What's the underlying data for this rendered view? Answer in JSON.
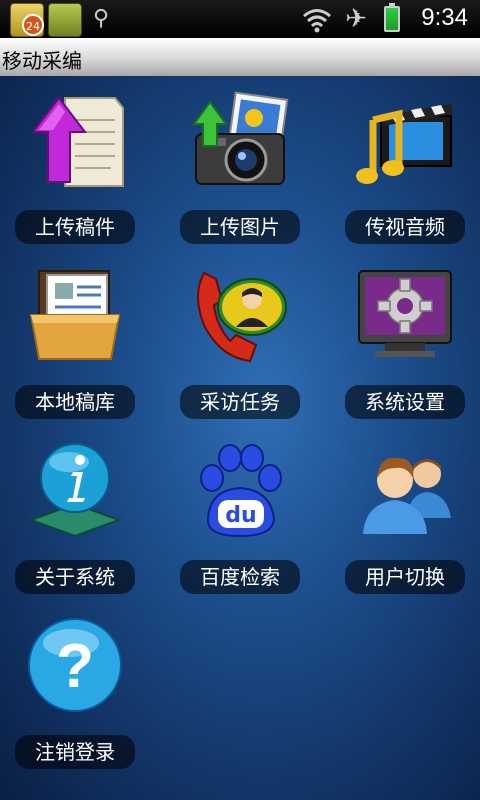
{
  "status_bar": {
    "notification_count": "24",
    "time": "9:34"
  },
  "title_bar": {
    "title": "移动采编"
  },
  "menu": {
    "items": [
      {
        "label": "上传稿件",
        "icon": "upload-document-icon"
      },
      {
        "label": "上传图片",
        "icon": "upload-picture-icon"
      },
      {
        "label": "传视音频",
        "icon": "media-music-video-icon"
      },
      {
        "label": "本地稿库",
        "icon": "local-archive-folder-icon"
      },
      {
        "label": "采访任务",
        "icon": "interview-phone-icon"
      },
      {
        "label": "系统设置",
        "icon": "settings-gear-icon"
      },
      {
        "label": "关于系统",
        "icon": "info-icon"
      },
      {
        "label": "百度检索",
        "icon": "baidu-search-icon"
      },
      {
        "label": "用户切换",
        "icon": "switch-user-icon"
      },
      {
        "label": "注销登录",
        "icon": "logout-help-icon"
      }
    ]
  }
}
